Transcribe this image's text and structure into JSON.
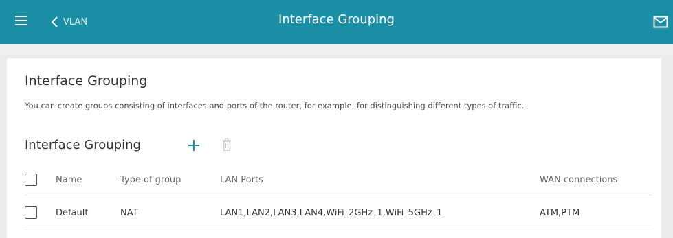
{
  "header": {
    "back_label": "VLAN",
    "title": "Interface Grouping",
    "menu_icon": "hamburger-menu-icon",
    "back_icon": "chevron-left-icon",
    "notification_icon": "mail-icon",
    "accent_color": "#1b8fa6"
  },
  "page": {
    "heading": "Interface Grouping",
    "description": "You can create groups consisting of interfaces and ports of the router, for example, for distinguishing different types of traffic."
  },
  "groups_section": {
    "heading": "Interface Grouping",
    "add_icon": "plus-icon",
    "delete_icon": "trash-icon"
  },
  "table": {
    "columns": [
      "Name",
      "Type of group",
      "LAN Ports",
      "WAN connections"
    ],
    "rows": [
      {
        "name": "Default",
        "type": "NAT",
        "lan_ports": "LAN1,LAN2,LAN3,LAN4,WiFi_2GHz_1,WiFi_5GHz_1",
        "wan_connections": "ATM,PTM"
      }
    ]
  }
}
